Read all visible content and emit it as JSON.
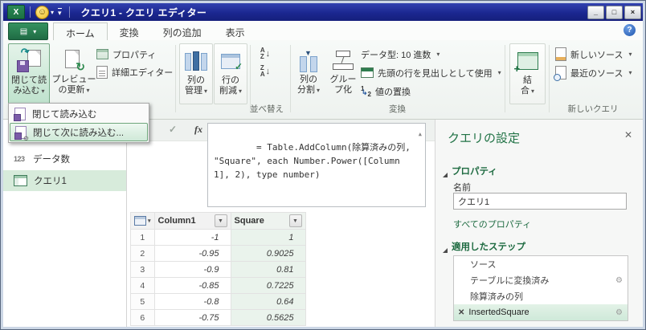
{
  "window": {
    "title": "クエリ1 - クエリ エディター",
    "minimize": "_",
    "maximize": "□",
    "close": "×",
    "help": "?"
  },
  "icons": {
    "excel": "X",
    "smiley": "☺",
    "caret_down": "▾",
    "qat_caret": "▾",
    "file_menu": "▤",
    "refresh": "↻",
    "check_mark": "✓",
    "sort_arrow": "↓",
    "split_caret": "▼",
    "plus": "+",
    "collapse": "▲",
    "gear": "⚙",
    "delete": "✕",
    "cancel": "✕",
    "fx": "fx"
  },
  "tabs": [
    {
      "label": "ホーム"
    },
    {
      "label": "変換"
    },
    {
      "label": "列の追加"
    },
    {
      "label": "表示"
    }
  ],
  "ribbon": {
    "close_load_l1": "閉じて読",
    "close_load_l2": "み込む",
    "refresh_l1": "プレビュー",
    "refresh_l2": "の更新",
    "properties": "プロパティ",
    "advanced_editor": "詳細エディター",
    "manage_columns_l1": "列の",
    "manage_columns_l2": "管理",
    "reduce_rows_l1": "行の",
    "reduce_rows_l2": "削減",
    "sort_az_top": "A",
    "sort_az_bottom": "Z",
    "sort_za_top": "Z",
    "sort_za_bottom": "A",
    "sort_group_label": "並べ替え",
    "split_l1": "列の",
    "split_l2": "分割",
    "group_l1": "グルー",
    "group_l2": "プ化",
    "data_type": "データ型: 10 進数",
    "first_row": "先頭の行を見出しとして使用",
    "replace_values": "値の置換",
    "replace_1": "1",
    "replace_2": "2",
    "transform_group_label": "変換",
    "combine_l1": "結",
    "combine_l2": "合",
    "new_source": "新しいソース",
    "recent_sources": "最近のソース",
    "new_query_group_label": "新しいクエリ"
  },
  "dropdown_menu": {
    "item1": "閉じて読み込む",
    "item2": "閉じて次に読み込む..."
  },
  "sidebar": {
    "item1_icon": "123",
    "item1_label": "データ数",
    "item2_label": "クエリ1"
  },
  "formula": {
    "text": "= Table.AddColumn(除算済みの列, \"Square\", each Number.Power([Column1], 2), type number)"
  },
  "table": {
    "col1": "Column1",
    "col2": "Square",
    "row_numbers": [
      "1",
      "2",
      "3",
      "4",
      "5",
      "6"
    ],
    "rows": [
      [
        "-1",
        "1"
      ],
      [
        "-0.95",
        "0.9025"
      ],
      [
        "-0.9",
        "0.81"
      ],
      [
        "-0.85",
        "0.7225"
      ],
      [
        "-0.8",
        "0.64"
      ],
      [
        "-0.75",
        "0.5625"
      ]
    ]
  },
  "panel": {
    "title": "クエリの設定",
    "properties_header": "プロパティ",
    "name_label": "名前",
    "name_value": "クエリ1",
    "all_properties": "すべてのプロパティ",
    "steps_header": "適用したステップ",
    "steps": [
      {
        "label": "ソース"
      },
      {
        "label": "テーブルに変換済み"
      },
      {
        "label": "除算済みの列"
      },
      {
        "label": "InsertedSquare"
      }
    ]
  },
  "colors": {
    "accent_green": "#217346",
    "titlebar_blue": "#1b2790",
    "selection_green": "#d7ebdb"
  }
}
